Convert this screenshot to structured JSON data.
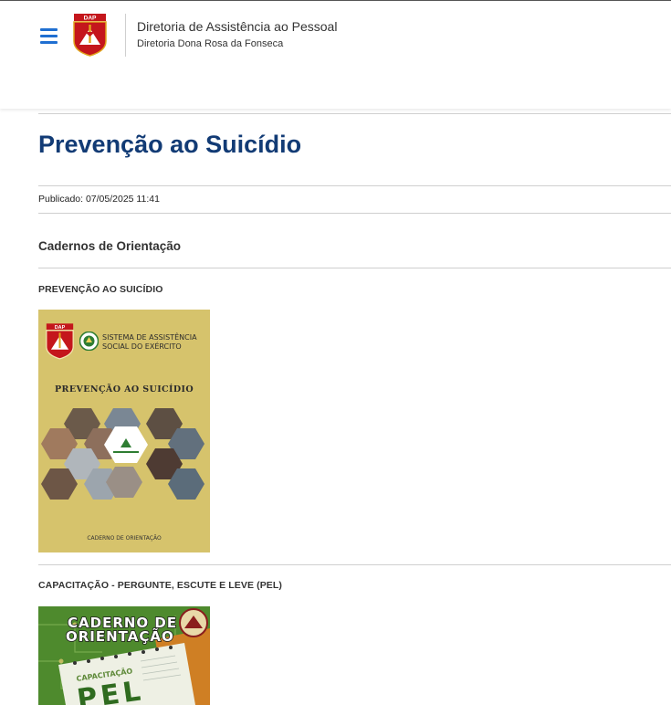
{
  "header": {
    "org_title": "Diretoria de Assistência ao Pessoal",
    "org_subtitle": "Diretoria Dona Rosa da Fonseca",
    "logo_text": "DAP"
  },
  "article": {
    "title": "Prevenção ao Suicídio",
    "published": "Publicado: 07/05/2025 11:41",
    "section_title": "Cadernos de Orientação"
  },
  "items": [
    {
      "heading": "PREVENÇÃO AO SUICÍDIO",
      "cover": {
        "logo_text": "DAP",
        "system_line1": "SISTEMA DE ASSISTÊNCIA",
        "system_line2": "SOCIAL DO EXÉRCITO",
        "title": "PREVENÇÃO AO SUICÍDIO",
        "footer": "CADERNO DE ORIENTAÇÃO",
        "background_color": "#d6c36c"
      }
    },
    {
      "heading": "CAPACITAÇÃO - PERGUNTE, ESCUTE E LEVE (PEL)",
      "cover": {
        "line1": "CADERNO DE",
        "line2": "ORIENTAÇÃO",
        "notepad_label": "CAPACITAÇÃO",
        "notepad_word": "PEL",
        "background_color": "#4e8a2d"
      }
    }
  ],
  "colors": {
    "title": "#123b75",
    "menu_icon": "#1f6fd1"
  }
}
